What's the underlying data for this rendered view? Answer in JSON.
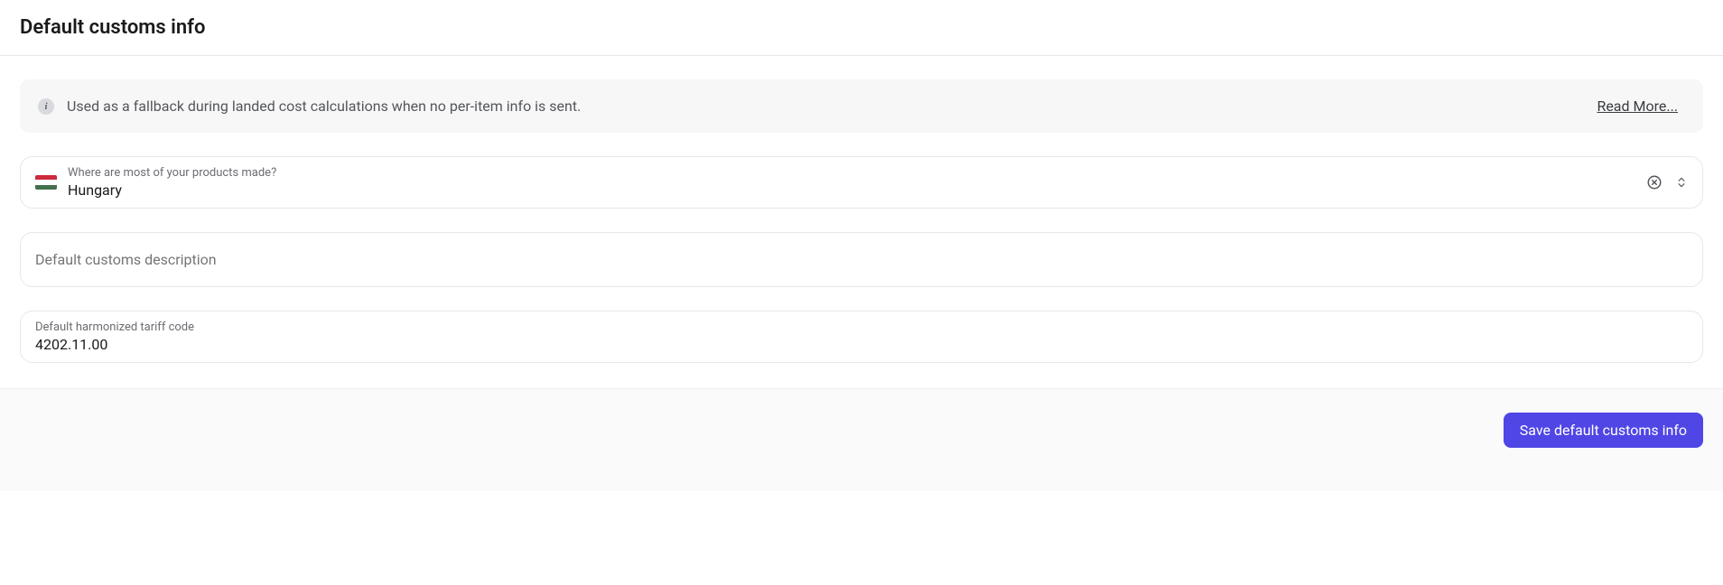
{
  "header": {
    "title": "Default customs info"
  },
  "banner": {
    "text": "Used as a fallback during landed cost calculations when no per-item info is sent.",
    "read_more": "Read More..."
  },
  "country_field": {
    "label": "Where are most of your products made?",
    "value": "Hungary"
  },
  "description_field": {
    "placeholder": "Default customs description",
    "value": ""
  },
  "tariff_field": {
    "label": "Default harmonized tariff code",
    "value": "4202.11.00"
  },
  "footer": {
    "save_label": "Save default customs info"
  }
}
